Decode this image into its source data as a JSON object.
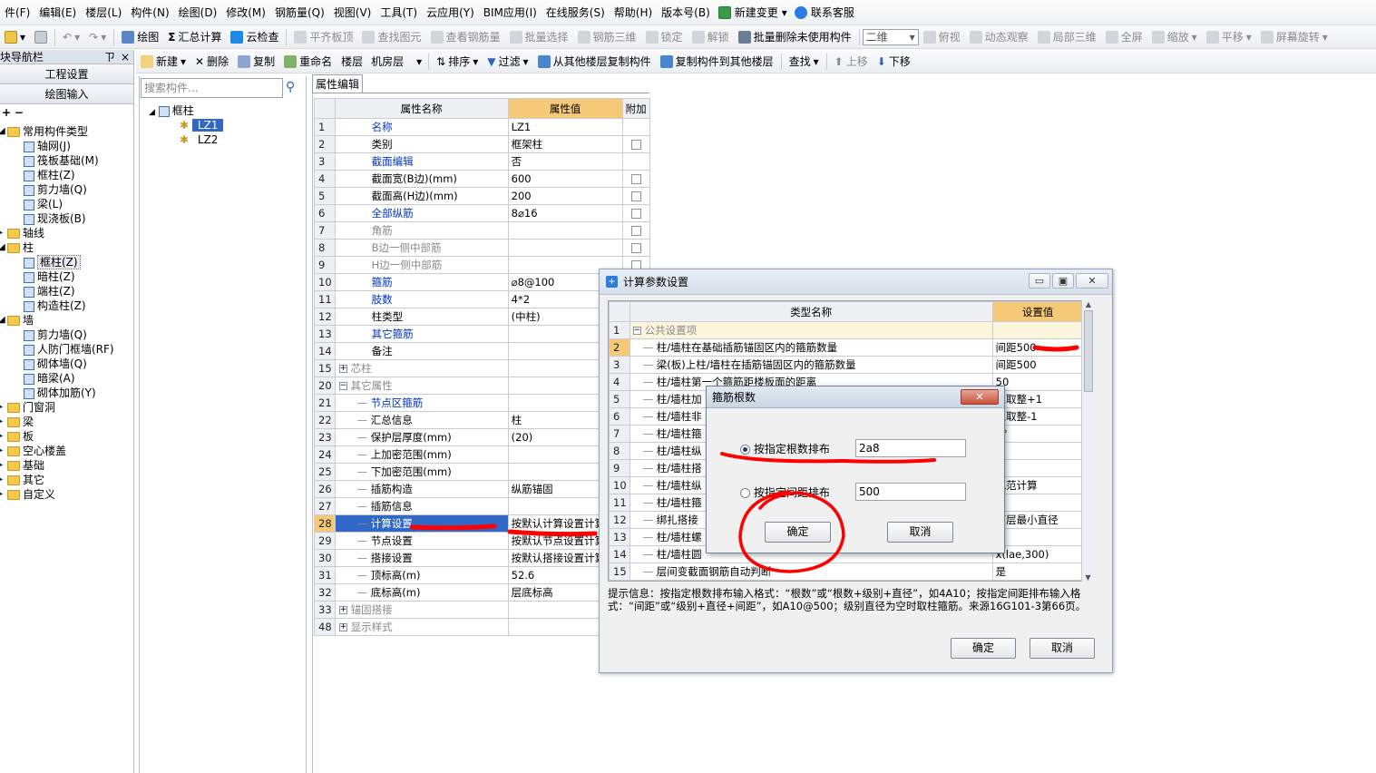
{
  "menu": [
    "件(F)",
    "编辑(E)",
    "楼层(L)",
    "构件(N)",
    "绘图(D)",
    "修改(M)",
    "钢筋量(Q)",
    "视图(V)",
    "工具(T)",
    "云应用(Y)",
    "BIM应用(I)",
    "在线服务(S)",
    "帮助(H)",
    "版本号(B)"
  ],
  "menu_change": "新建变更",
  "menu_service": "联系客服",
  "toolbar1": {
    "draw": "绘图",
    "sum": "汇总计算",
    "cloud": "云检查",
    "flat": "平齐板顶",
    "find": "查找图元",
    "view_rebar": "查看钢筋量",
    "batch": "批量选择",
    "rebar3d": "钢筋三维",
    "lock": "锁定",
    "unlock": "解锁",
    "batch_delete": "批量删除未使用构件",
    "mode": "二维",
    "top": "俯视",
    "dynamic": "动态观察",
    "local3d": "局部三维",
    "full": "全屏",
    "zoom": "缩放",
    "pan": "平移",
    "rotate": "屏幕旋转"
  },
  "nav": {
    "title": "块导航栏",
    "pin": "ㄗ",
    "close": "×",
    "btn1": "工程设置",
    "btn2": "绘图输入"
  },
  "toolbar2": {
    "new": "新建",
    "delete": "删除",
    "copy": "复制",
    "rename": "重命名",
    "floor_label": "楼层",
    "floor_value": "机房层",
    "sort": "排序",
    "filter": "过滤",
    "copy_from": "从其他楼层复制构件",
    "copy_to": "复制构件到其他楼层",
    "find": "查找",
    "up": "上移",
    "down": "下移"
  },
  "tree": [
    {
      "label": "常用构件类型",
      "level": 0,
      "folder": true,
      "exp": "−"
    },
    {
      "label": "轴网(J)",
      "level": 1
    },
    {
      "label": "筏板基础(M)",
      "level": 1
    },
    {
      "label": "框柱(Z)",
      "level": 1
    },
    {
      "label": "剪力墙(Q)",
      "level": 1
    },
    {
      "label": "梁(L)",
      "level": 1
    },
    {
      "label": "现浇板(B)",
      "level": 1
    },
    {
      "label": "轴线",
      "level": 0,
      "folder": true,
      "exp": "+"
    },
    {
      "label": "柱",
      "level": 0,
      "folder": true,
      "exp": "−"
    },
    {
      "label": "框柱(Z)",
      "level": 1,
      "sel": true
    },
    {
      "label": "暗柱(Z)",
      "level": 1
    },
    {
      "label": "端柱(Z)",
      "level": 1
    },
    {
      "label": "构造柱(Z)",
      "level": 1
    },
    {
      "label": "墙",
      "level": 0,
      "folder": true,
      "exp": "−"
    },
    {
      "label": "剪力墙(Q)",
      "level": 1
    },
    {
      "label": "人防门框墙(RF)",
      "level": 1
    },
    {
      "label": "砌体墙(Q)",
      "level": 1
    },
    {
      "label": "暗梁(A)",
      "level": 1
    },
    {
      "label": "砌体加筋(Y)",
      "level": 1
    },
    {
      "label": "门窗洞",
      "level": 0,
      "folder": true,
      "exp": "+"
    },
    {
      "label": "梁",
      "level": 0,
      "folder": true,
      "exp": "+"
    },
    {
      "label": "板",
      "level": 0,
      "folder": true,
      "exp": "+"
    },
    {
      "label": "空心楼盖",
      "level": 0,
      "folder": true,
      "exp": "+"
    },
    {
      "label": "基础",
      "level": 0,
      "folder": true,
      "exp": "+"
    },
    {
      "label": "其它",
      "level": 0,
      "folder": true,
      "exp": "+"
    },
    {
      "label": "自定义",
      "level": 0,
      "folder": true,
      "exp": "+"
    }
  ],
  "search_placeholder": "搜索构件...",
  "comp_tree": {
    "root": "框柱",
    "items": [
      "LZ1",
      "LZ2"
    ]
  },
  "prop_tab": "属性编辑",
  "prop_headers": [
    "属性名称",
    "属性值",
    "附加"
  ],
  "props": [
    {
      "n": "1",
      "name": "名称",
      "val": "LZ1",
      "blue": true,
      "cb": false
    },
    {
      "n": "2",
      "name": "类别",
      "val": "框架柱",
      "cb": true
    },
    {
      "n": "3",
      "name": "截面编辑",
      "val": "否",
      "blue": true,
      "cb": false
    },
    {
      "n": "4",
      "name": "截面宽(B边)(mm)",
      "val": "600",
      "cb": true
    },
    {
      "n": "5",
      "name": "截面高(H边)(mm)",
      "val": "200",
      "cb": true
    },
    {
      "n": "6",
      "name": "全部纵筋",
      "val": "8⌀16",
      "blue": true,
      "cb": true
    },
    {
      "n": "7",
      "name": "角筋",
      "val": "",
      "gray": true,
      "cb": true
    },
    {
      "n": "8",
      "name": "B边一侧中部筋",
      "val": "",
      "gray": true,
      "cb": true
    },
    {
      "n": "9",
      "name": "H边一侧中部筋",
      "val": "",
      "gray": true,
      "cb": true
    },
    {
      "n": "10",
      "name": "箍筋",
      "val": "⌀8@100",
      "blue": true,
      "cb": true
    },
    {
      "n": "11",
      "name": "肢数",
      "val": "4*2",
      "blue": true,
      "cb": false
    },
    {
      "n": "12",
      "name": "柱类型",
      "val": "(中柱)",
      "cb": true
    },
    {
      "n": "13",
      "name": "其它箍筋",
      "val": "",
      "blue": true,
      "cb": false
    },
    {
      "n": "14",
      "name": "备注",
      "val": "",
      "cb": true
    },
    {
      "n": "15",
      "name": "芯柱",
      "val": "",
      "gray": true,
      "pm": "+",
      "cb": false
    },
    {
      "n": "20",
      "name": "其它属性",
      "val": "",
      "gray": true,
      "pm": "−",
      "cb": false
    },
    {
      "n": "21",
      "name": "节点区箍筋",
      "val": "",
      "blue": true,
      "indent": true,
      "cb": false
    },
    {
      "n": "22",
      "name": "汇总信息",
      "val": "柱",
      "indent": true,
      "cb": false
    },
    {
      "n": "23",
      "name": "保护层厚度(mm)",
      "val": "(20)",
      "indent": true,
      "cb": false
    },
    {
      "n": "24",
      "name": "上加密范围(mm)",
      "val": "",
      "indent": true,
      "cb": false
    },
    {
      "n": "25",
      "name": "下加密范围(mm)",
      "val": "",
      "indent": true,
      "cb": false
    },
    {
      "n": "26",
      "name": "插筋构造",
      "val": "纵筋锚固",
      "indent": true,
      "cb": false
    },
    {
      "n": "27",
      "name": "插筋信息",
      "val": "",
      "indent": true,
      "cb": false
    },
    {
      "n": "28",
      "name": "计算设置",
      "val": "按默认计算设置计算",
      "indent": true,
      "sel": true,
      "cb": false
    },
    {
      "n": "29",
      "name": "节点设置",
      "val": "按默认节点设置计算",
      "indent": true,
      "cb": false
    },
    {
      "n": "30",
      "name": "搭接设置",
      "val": "按默认搭接设置计算",
      "indent": true,
      "cb": false
    },
    {
      "n": "31",
      "name": "顶标高(m)",
      "val": "52.6",
      "indent": true,
      "cb": false
    },
    {
      "n": "32",
      "name": "底标高(m)",
      "val": "层底标高",
      "indent": true,
      "cb": false
    },
    {
      "n": "33",
      "name": "锚固搭接",
      "val": "",
      "gray": true,
      "pm": "+",
      "cb": false
    },
    {
      "n": "48",
      "name": "显示样式",
      "val": "",
      "gray": true,
      "pm": "+",
      "cb": false
    }
  ],
  "dialog": {
    "title": "计算参数设置",
    "headers": [
      "类型名称",
      "设置值"
    ],
    "rows": [
      {
        "n": "1",
        "name": "公共设置项",
        "val": "",
        "group": true
      },
      {
        "n": "2",
        "name": "柱/墙柱在基础插筋锚固区内的箍筋数量",
        "val": "间距500",
        "sel": true
      },
      {
        "n": "3",
        "name": "梁(板)上柱/墙柱在插筋锚固区内的箍筋数量",
        "val": "间距500"
      },
      {
        "n": "4",
        "name": "柱/墙柱第一个箍筋距楼板面的距离",
        "val": "50"
      },
      {
        "n": "5",
        "name": "柱/墙柱加",
        "val": "上取整+1"
      },
      {
        "n": "6",
        "name": "柱/墙柱非",
        "val": "上取整-1"
      },
      {
        "n": "7",
        "name": "柱/墙柱箍",
        "val": "5°"
      },
      {
        "n": "8",
        "name": "柱/墙柱纵",
        "val": "%",
        "gray": true
      },
      {
        "n": "9",
        "name": "柱/墙柱搭",
        "val": ""
      },
      {
        "n": "10",
        "name": "柱/墙柱纵",
        "val": "规范计算"
      },
      {
        "n": "11",
        "name": "柱/墙柱箍",
        "val": ""
      },
      {
        "n": "12",
        "name": "绑扎搭接",
        "val": "下层最小直径"
      },
      {
        "n": "13",
        "name": "柱/墙柱螺",
        "val": ""
      },
      {
        "n": "14",
        "name": "柱/墙柱圆",
        "val": "x(lae,300)"
      },
      {
        "n": "15",
        "name": "层间变截面钢筋自动判断",
        "val": "是"
      }
    ],
    "hint": "提示信息：按指定根数排布输入格式：“根数”或“根数+级别+直径”，如4A10；按指定间距排布输入格式：“间距”或“级别+直径+间距”，如A10@500；级别直径为空时取柱箍筋。来源16G101-3第66页。",
    "ok": "确定",
    "cancel": "取消",
    "min": "▭",
    "max": "▣",
    "close": "✕"
  },
  "stirrup": {
    "title": "箍筋根数",
    "opt1": "按指定根数排布",
    "val1": "2a8",
    "opt2": "按指定间距排布",
    "val2": "500",
    "ok": "确定",
    "cancel": "取消",
    "close": "✕"
  }
}
